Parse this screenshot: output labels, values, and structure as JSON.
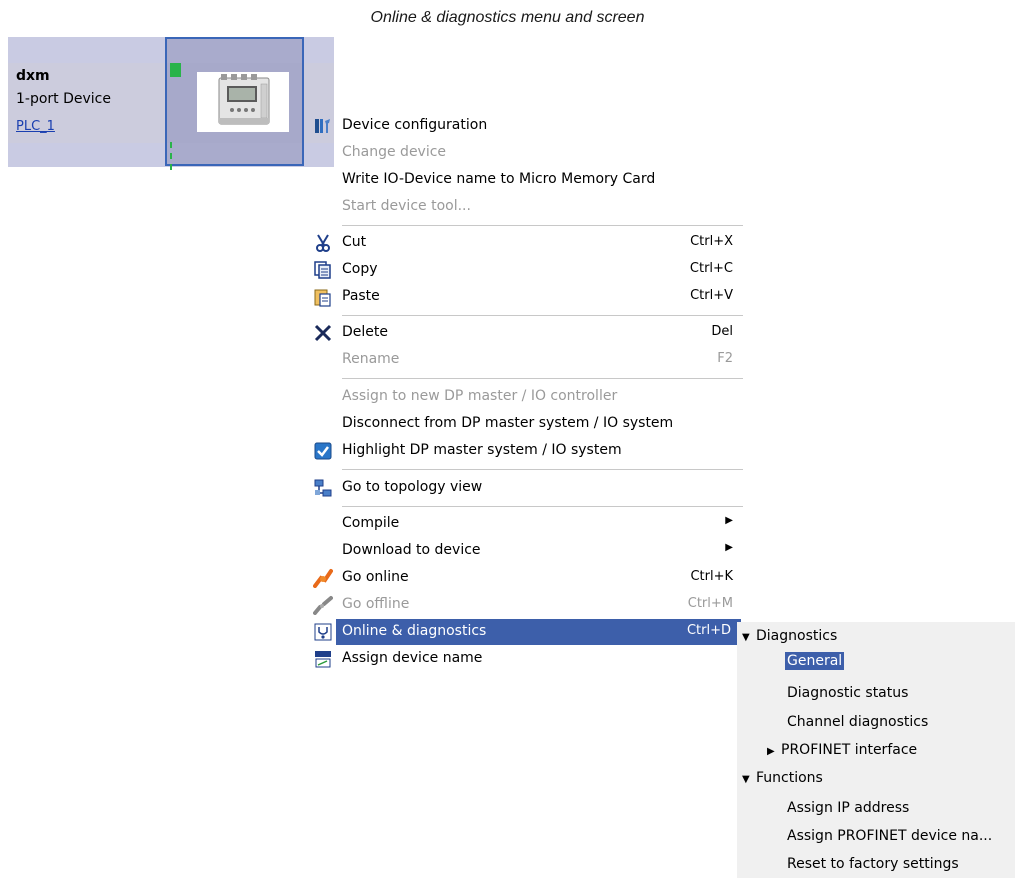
{
  "caption": "Online & diagnostics menu and screen",
  "device": {
    "name": "dxm",
    "type": "1-port Device",
    "plc_link": "PLC_1"
  },
  "menu": {
    "device_configuration": "Device configuration",
    "change_device": "Change device",
    "write_io_name": "Write IO-Device name to Micro Memory Card",
    "start_device_tool": "Start device tool...",
    "cut": "Cut",
    "cut_sc": "Ctrl+X",
    "copy": "Copy",
    "copy_sc": "Ctrl+C",
    "paste": "Paste",
    "paste_sc": "Ctrl+V",
    "delete": "Delete",
    "delete_sc": "Del",
    "rename": "Rename",
    "rename_sc": "F2",
    "assign_new_dp": "Assign to new DP master / IO controller",
    "disconnect_dp": "Disconnect from DP master system / IO system",
    "highlight_dp": "Highlight DP master system / IO system",
    "go_topology": "Go to topology view",
    "compile": "Compile",
    "download": "Download to device",
    "go_online": "Go online",
    "go_online_sc": "Ctrl+K",
    "go_offline": "Go offline",
    "go_offline_sc": "Ctrl+M",
    "online_diag": "Online & diagnostics",
    "online_diag_sc": "Ctrl+D",
    "assign_name": "Assign device name"
  },
  "submenu": {
    "diagnostics": "Diagnostics",
    "general": "General",
    "diagnostic_status": "Diagnostic status",
    "channel_diagnostics": "Channel diagnostics",
    "profinet_interface": "PROFINET interface",
    "functions": "Functions",
    "assign_ip": "Assign IP address",
    "assign_profinet_name": "Assign PROFINET device na...",
    "reset_factory": "Reset to factory settings"
  },
  "colors": {
    "highlight": "#3d5faa",
    "panel": "#c9cbe3",
    "device_border": "#3a66b8",
    "green": "#29b34a"
  }
}
